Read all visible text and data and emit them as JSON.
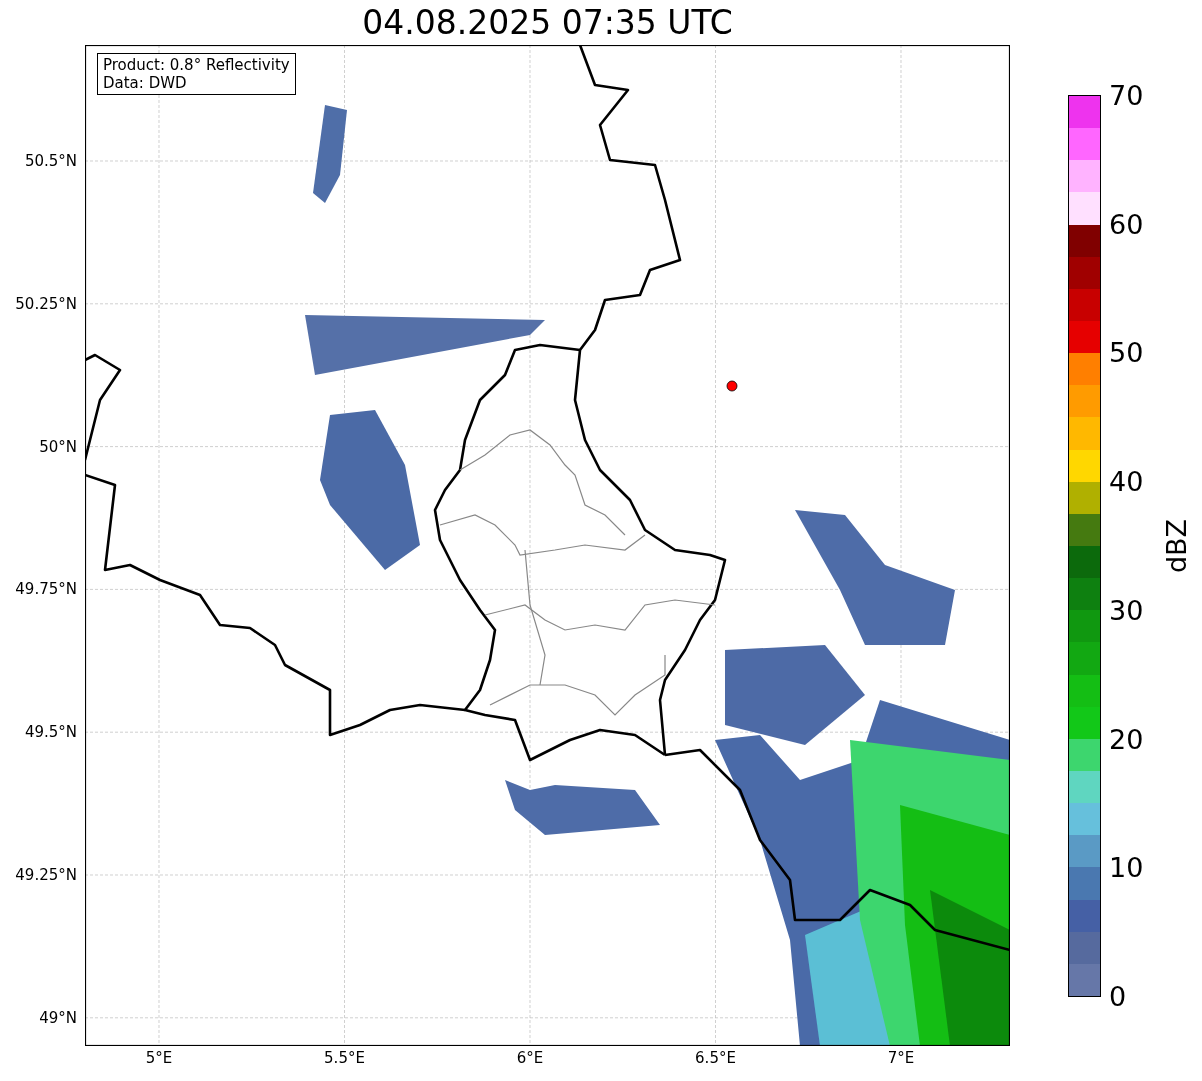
{
  "title": "04.08.2025 07:35 UTC",
  "map": {
    "legend": [
      "Product: 0.8° Reflectivity",
      "Data: DWD"
    ],
    "y_ticks": [
      "50.5°N",
      "50.25°N",
      "50°N",
      "49.75°N",
      "49.5°N",
      "49.25°N",
      "49°N"
    ],
    "x_ticks": [
      "5°E",
      "5.5°E",
      "6°E",
      "6.5°E",
      "7°E"
    ]
  },
  "colorbar": {
    "ticks": [
      "70",
      "60",
      "50",
      "40",
      "30",
      "20",
      "10",
      "0"
    ],
    "colors": [
      {
        "color": "#ee33ee"
      },
      {
        "color": "#ff66ff"
      },
      {
        "color": "#ffb3ff"
      },
      {
        "color": "#ffe0ff"
      },
      {
        "color": "#800000"
      },
      {
        "color": "#a00000"
      },
      {
        "color": "#c80000"
      },
      {
        "color": "#e60000"
      },
      {
        "color": "#ff7f00"
      },
      {
        "color": "#ff9b00"
      },
      {
        "color": "#ffb800"
      },
      {
        "color": "#ffd700"
      },
      {
        "color": "#b0b000"
      },
      {
        "color": "#457a10"
      },
      {
        "color": "#0c6a0c"
      },
      {
        "color": "#0e8010"
      },
      {
        "color": "#109810"
      },
      {
        "color": "#12a812"
      },
      {
        "color": "#14be14"
      },
      {
        "color": "#12c818"
      },
      {
        "color": "#3dd66e"
      },
      {
        "color": "#5fd6c0"
      },
      {
        "color": "#66c0dc"
      },
      {
        "color": "#5a9ac5"
      },
      {
        "color": "#4a78b0"
      },
      {
        "color": "#4560a5"
      },
      {
        "color": "#566a9e"
      },
      {
        "color": "#6677a8"
      }
    ],
    "label": "dBZ"
  }
}
